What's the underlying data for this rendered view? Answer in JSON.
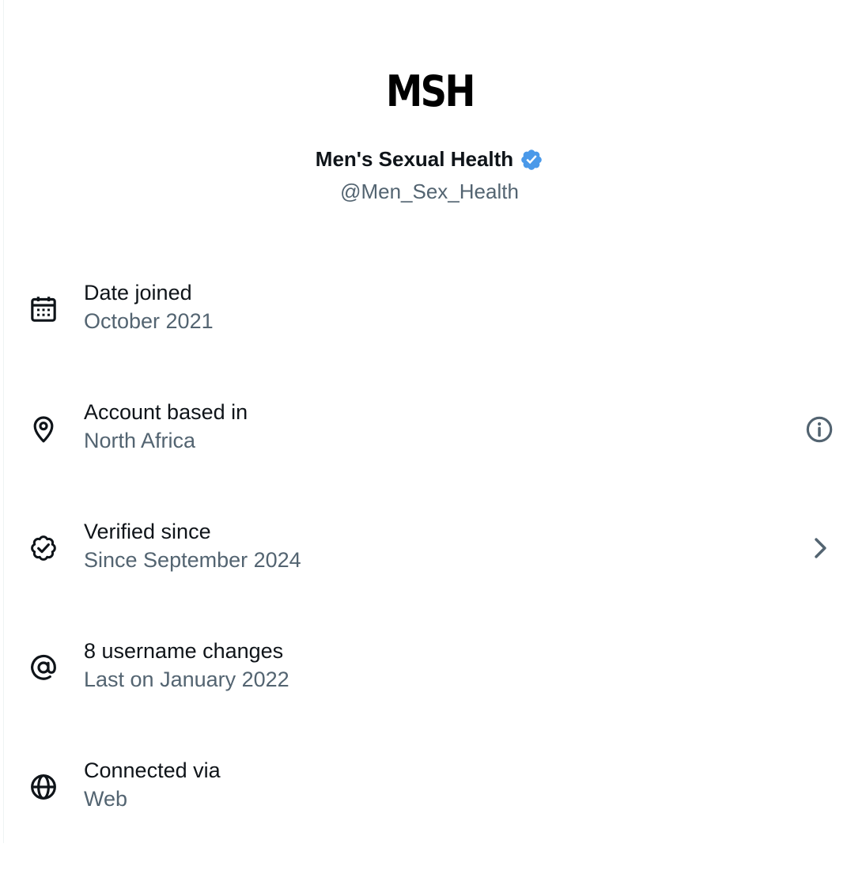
{
  "profile": {
    "avatar_text": "MSH",
    "display_name": "Men's Sexual Health",
    "handle": "@Men_Sex_Health",
    "verified": true,
    "verified_badge_color": "#4a99e9"
  },
  "about": {
    "rows": [
      {
        "icon": "calendar-icon",
        "title": "Date joined",
        "value": "October 2021"
      },
      {
        "icon": "location-pin-icon",
        "title": "Account based in",
        "value": "North Africa",
        "trailing_icon": "info-icon"
      },
      {
        "icon": "verified-badge-outline-icon",
        "title": "Verified since",
        "value": "Since September 2024",
        "trailing_icon": "chevron-right-icon"
      },
      {
        "icon": "at-sign-icon",
        "title": "8 username changes",
        "value": "Last on January 2022"
      },
      {
        "icon": "globe-icon",
        "title": "Connected via",
        "value": "Web"
      }
    ]
  },
  "colors": {
    "primary_text": "#0f1419",
    "secondary_text": "#536471",
    "background": "#ffffff"
  }
}
